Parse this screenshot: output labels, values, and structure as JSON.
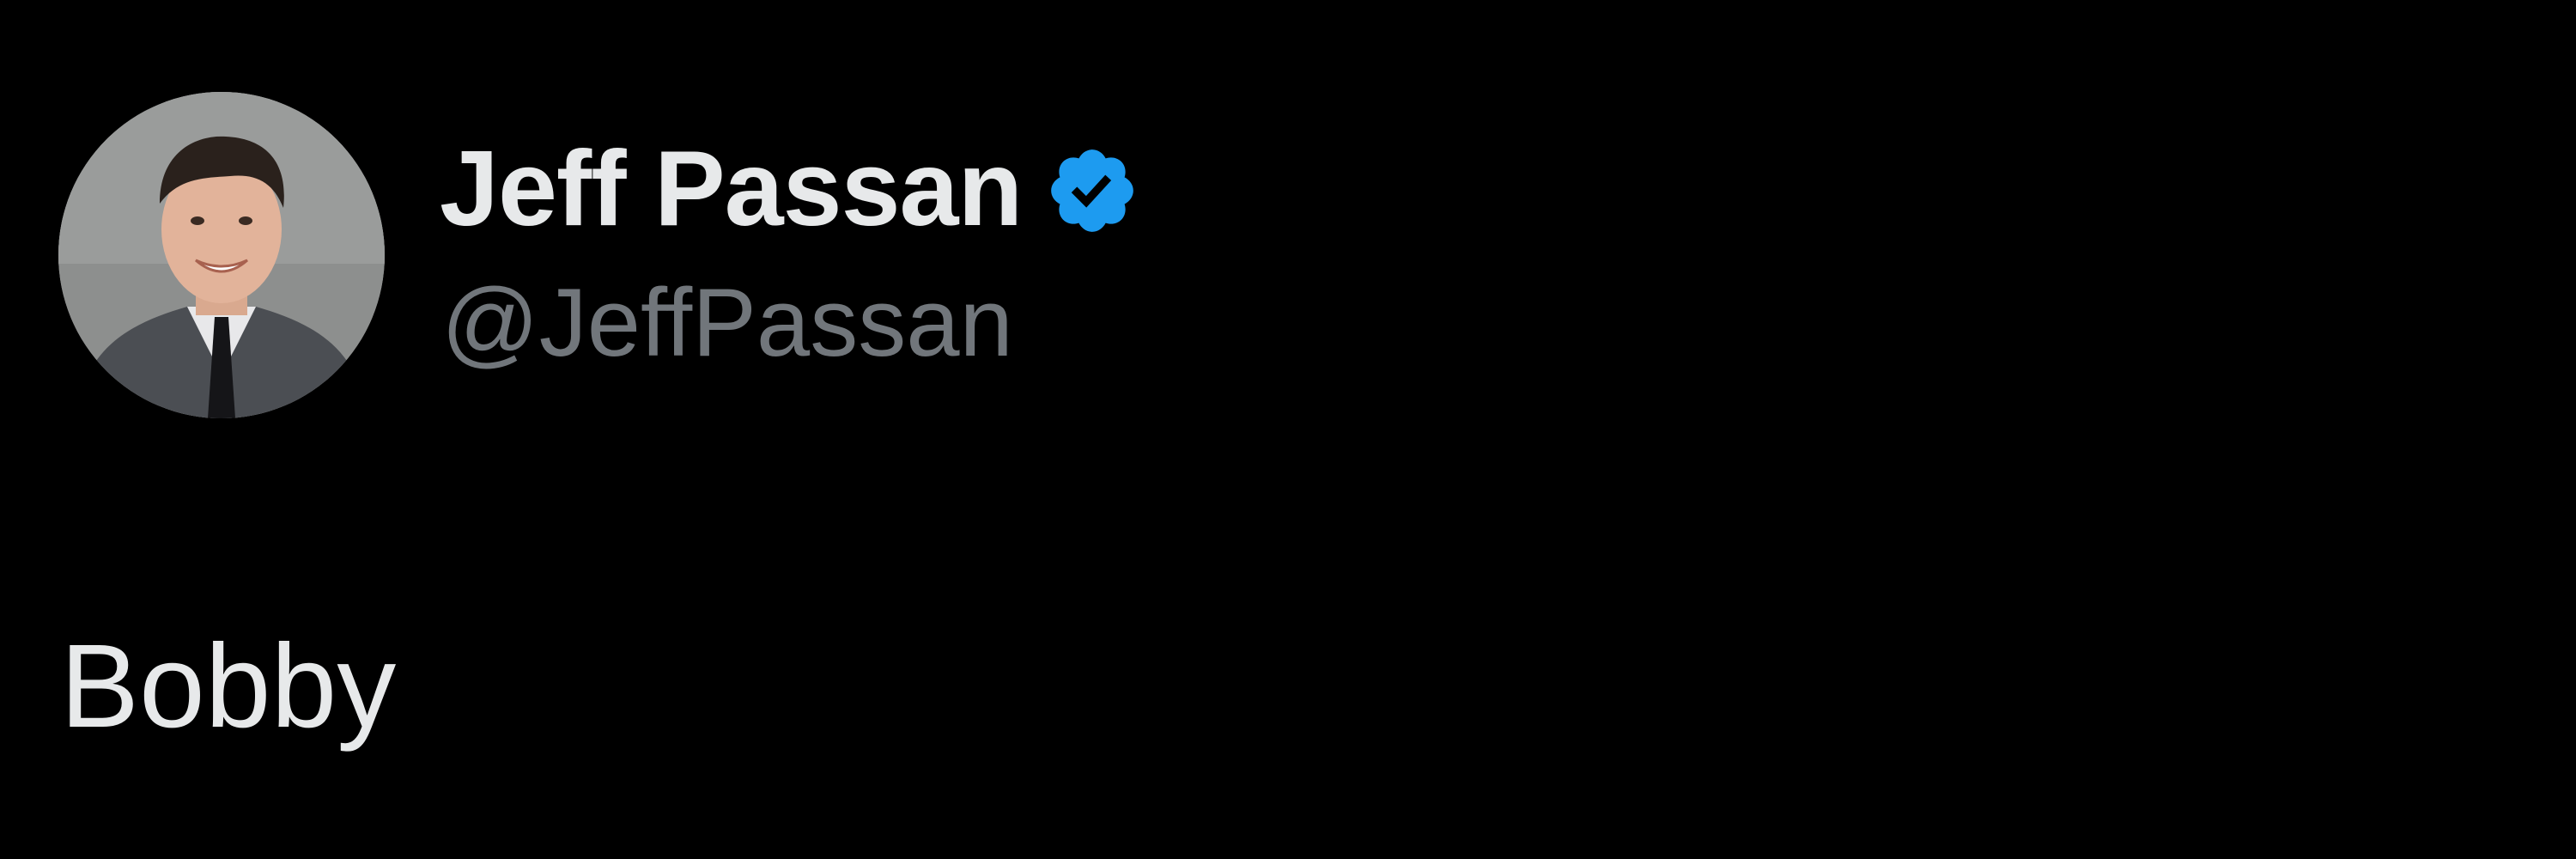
{
  "tweet": {
    "author": {
      "display_name": "Jeff Passan",
      "handle": "@JeffPassan",
      "verified": true,
      "avatar_icon": "profile-photo"
    },
    "text": "Bobby"
  },
  "colors": {
    "background": "#000000",
    "primary_text": "#e7e9ea",
    "secondary_text": "#71767b",
    "verified_blue": "#1d9bf0"
  }
}
